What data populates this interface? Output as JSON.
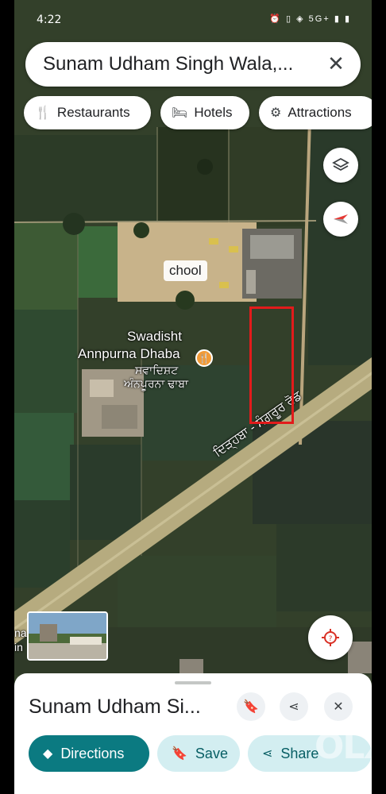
{
  "status_bar": {
    "time": "4:22",
    "icons": "⏰ ▯ ◈ 5G+ ▮ ▮"
  },
  "search": {
    "query": "Sunam Udham Singh Wala,...",
    "close_icon": "close-icon"
  },
  "chips": [
    {
      "label": "Restaurants",
      "icon": "fork-knife-icon"
    },
    {
      "label": "Hotels",
      "icon": "bed-icon"
    },
    {
      "label": "Attractions",
      "icon": "attraction-icon"
    }
  ],
  "map": {
    "school_label": "chool",
    "poi_name_line1": "Swadisht",
    "poi_name_line2": "Annpurna Dhaba",
    "poi_name_local1": "ਸਵਾਦਿਸ਼ਟ",
    "poi_name_local2": "ਅੰਨਪੂਰਨਾ ਢਾਬਾ",
    "road_label": "ਦਿੜ੍ਹਬਾ - ਸੰਗਰੂਰ ਰੋਡ",
    "edge_text": "na\nin"
  },
  "place": {
    "title": "Sunam Udham Si..."
  },
  "actions": {
    "directions": "Directions",
    "save": "Save",
    "share": "Share"
  },
  "watermark": "OLX"
}
